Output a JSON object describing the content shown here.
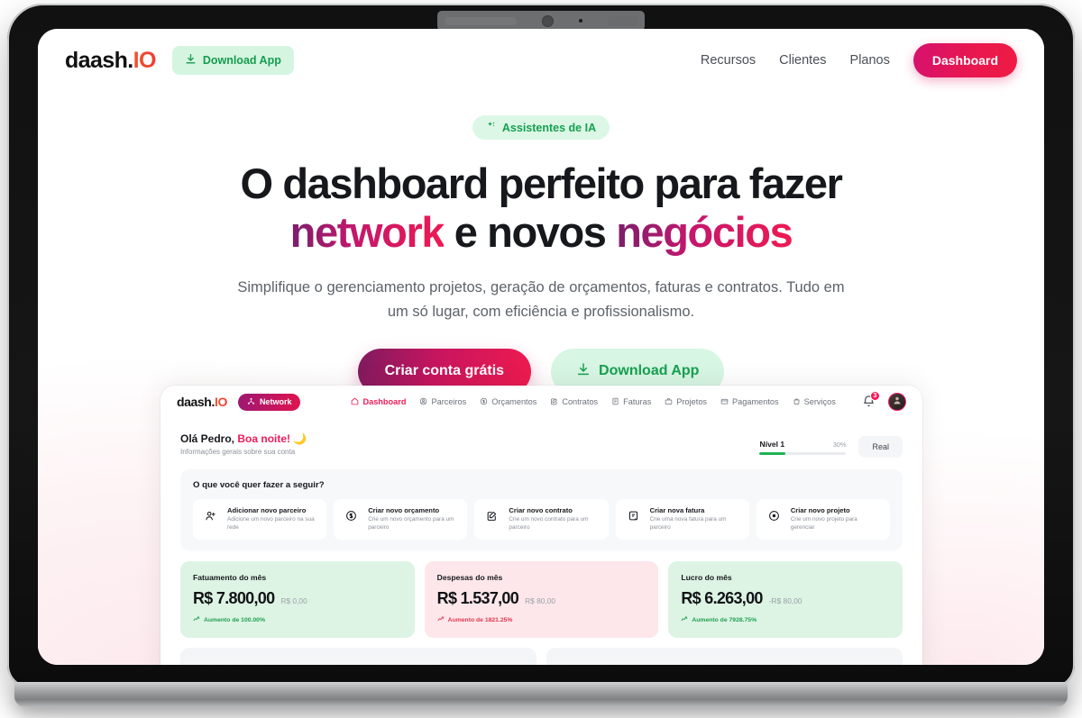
{
  "site": {
    "brand": {
      "name": "daash.",
      "suffix": "IO"
    },
    "download_button": {
      "label": "Download App",
      "icon": "download-icon"
    },
    "nav": [
      {
        "label": "Recursos"
      },
      {
        "label": "Clientes"
      },
      {
        "label": "Planos"
      }
    ],
    "dashboard_button": {
      "label": "Dashboard"
    }
  },
  "hero": {
    "badge": {
      "label": "Assistentes de IA",
      "icon": "sparkles-icon"
    },
    "title_line1": "O dashboard perfeito para fazer",
    "title_word_network": "network",
    "title_mid": " e novos ",
    "title_word_negocios": "negócios",
    "subtitle": "Simplifique o gerenciamento projetos, geração de orçamentos, faturas e contratos. Tudo em um só lugar, com eficiência e profissionalismo.",
    "cta_primary": "Criar conta grátis",
    "cta_secondary": "Download App"
  },
  "app": {
    "brand": {
      "name": "daash.",
      "suffix": "IO"
    },
    "network_badge": {
      "label": "Network",
      "icon": "network-icon"
    },
    "nav": [
      {
        "label": "Dashboard",
        "icon": "home-icon",
        "active": true
      },
      {
        "label": "Parceiros",
        "icon": "users-icon",
        "active": false
      },
      {
        "label": "Orçamentos",
        "icon": "coin-icon",
        "active": false
      },
      {
        "label": "Contratos",
        "icon": "edit-doc-icon",
        "active": false
      },
      {
        "label": "Faturas",
        "icon": "invoice-icon",
        "active": false
      },
      {
        "label": "Projetos",
        "icon": "briefcase-icon",
        "active": false
      },
      {
        "label": "Pagamentos",
        "icon": "card-icon",
        "active": false
      },
      {
        "label": "Serviços",
        "icon": "bag-icon",
        "active": false
      }
    ],
    "notifications": {
      "icon": "bell-icon",
      "count": "3"
    },
    "avatar": {
      "icon": "avatar-icon"
    },
    "greeting": {
      "name": "Olá Pedro,",
      "salutation": "Boa noite!",
      "emoji": "🌙",
      "subtitle": "Informações gerais sobre sua conta"
    },
    "level": {
      "name": "Nível 1",
      "percent": "30%",
      "fill": 30
    },
    "currency_button": "Real",
    "actions_panel": {
      "title": "O que você quer fazer a seguir?",
      "items": [
        {
          "title": "Adicionar novo parceiro",
          "desc": "Adicione um novo parceiro na sua rede",
          "icon": "user-plus-icon"
        },
        {
          "title": "Criar novo orçamento",
          "desc": "Crie um novo orçamento para um parceiro",
          "icon": "coin-icon"
        },
        {
          "title": "Criar novo contrato",
          "desc": "Crie um novo contrato para um parceiro",
          "icon": "edit-doc-icon"
        },
        {
          "title": "Criar nova fatura",
          "desc": "Crie uma nova fatura para um parceiro",
          "icon": "invoice-icon"
        },
        {
          "title": "Criar novo projeto",
          "desc": "Crie um novo projeto para gerenciar",
          "icon": "target-icon"
        }
      ]
    },
    "stats": [
      {
        "label": "Fatuamento do mês",
        "value": "R$ 7.800,00",
        "previous": "R$ 0,00",
        "delta": "Aumento de 100.00%",
        "tone": "green",
        "direction": "up"
      },
      {
        "label": "Despesas do mês",
        "value": "R$ 1.537,00",
        "previous": "R$ 80,00",
        "delta": "Aumento de 1821.25%",
        "tone": "pink",
        "direction": "down"
      },
      {
        "label": "Lucro do mês",
        "value": "R$ 6.263,00",
        "previous": "-R$ 80,00",
        "delta": "Aumento de 7928.75%",
        "tone": "green",
        "direction": "up"
      }
    ]
  },
  "colors": {
    "brand_pink": "#ef1b58",
    "brand_magenta": "#c8155f",
    "brand_purple": "#7e1b5f",
    "green": "#17a050",
    "green_bg": "#d7f6e3",
    "pink_bg": "#fde7ea",
    "red": "#e5354d"
  }
}
